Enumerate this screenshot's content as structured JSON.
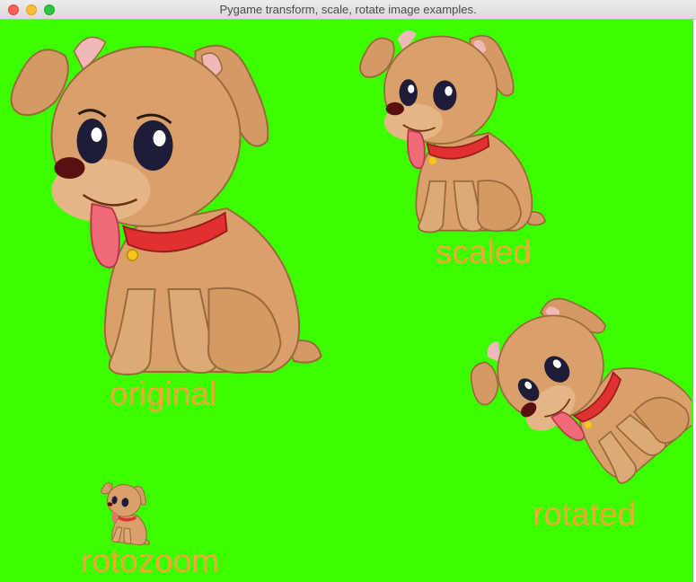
{
  "window": {
    "title": "Pygame transform, scale, rotate image examples."
  },
  "canvas": {
    "background_color": "#3cff00",
    "label_color": "#f3a63a"
  },
  "sprites": {
    "original": {
      "label": "original",
      "icon": "puppy-image"
    },
    "scaled": {
      "label": "scaled",
      "icon": "puppy-image"
    },
    "rotated": {
      "label": "rotated",
      "icon": "puppy-image"
    },
    "rotozoom": {
      "label": "rotozoom",
      "icon": "puppy-image"
    }
  }
}
